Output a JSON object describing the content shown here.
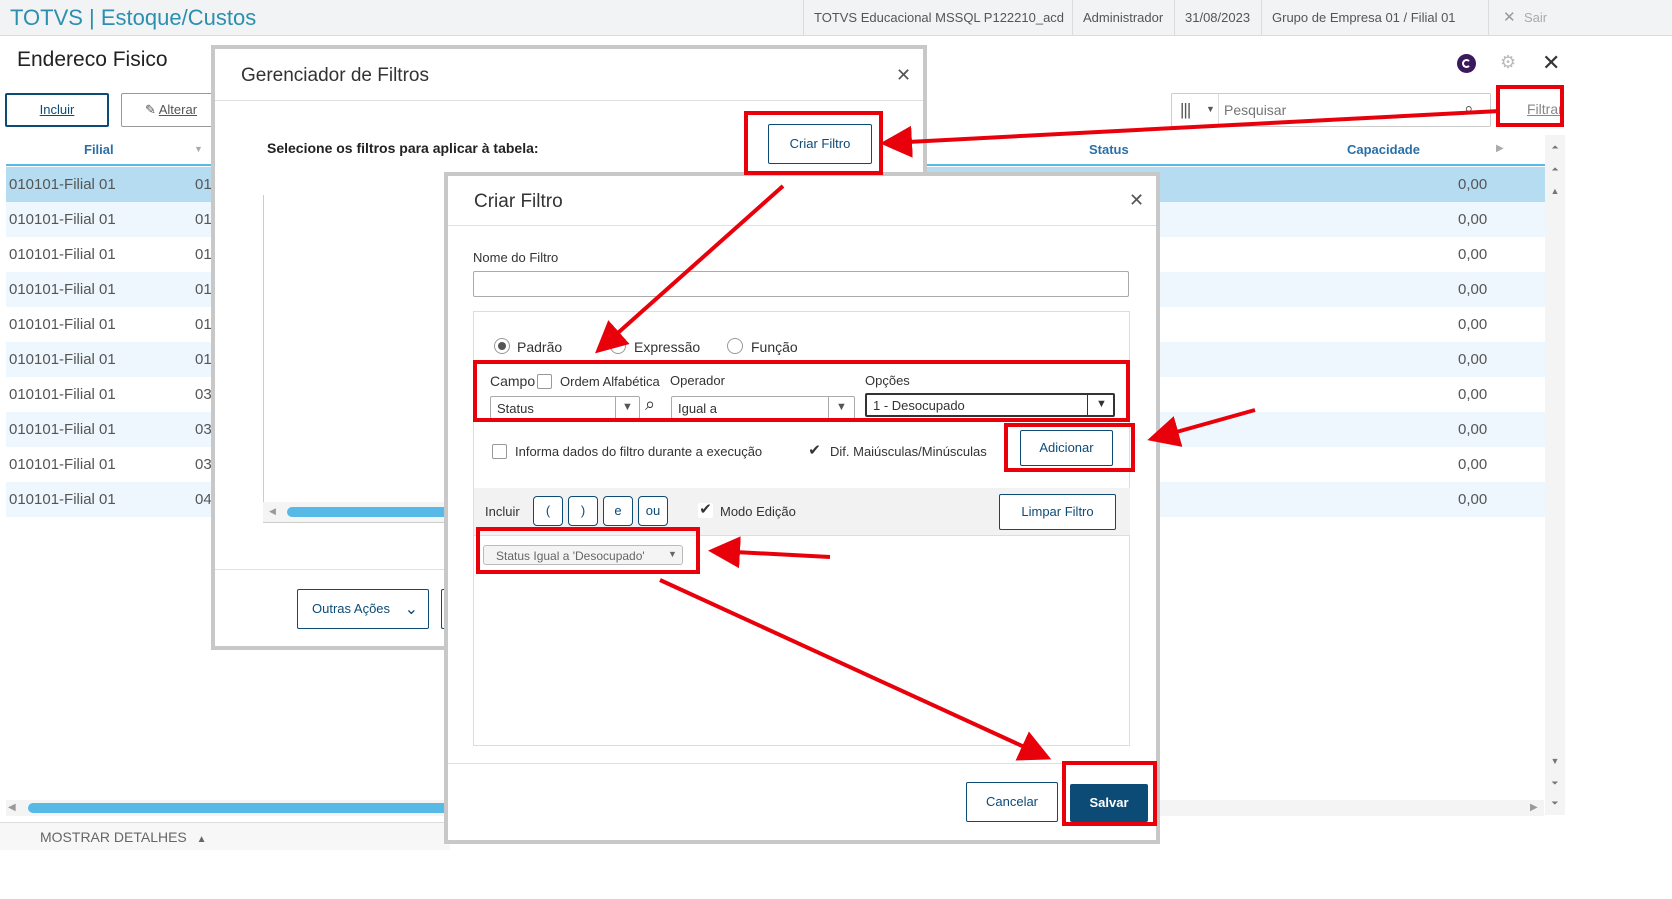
{
  "app": {
    "title": "TOTVS | Estoque/Custos",
    "environment": "TOTVS Educacional MSSQL P122210_acd",
    "user": "Administrador",
    "date": "31/08/2023",
    "company": "Grupo de Empresa 01 / Filial 01",
    "exit_label": "Sair"
  },
  "page": {
    "title": "Endereco Fisico",
    "include_label": "Incluir",
    "alter_label": "Alterar",
    "search_placeholder": "Pesquisar",
    "filter_label": "Filtrar",
    "show_details_label": "MOSTRAR DETALHES"
  },
  "grid": {
    "headers": {
      "filial": "Filial",
      "status": "Status",
      "capacidade": "Capacidade"
    },
    "rows": [
      {
        "filial": "010101-Filial 01",
        "code": "01",
        "capacidade": "0,00"
      },
      {
        "filial": "010101-Filial 01",
        "code": "01",
        "capacidade": "0,00"
      },
      {
        "filial": "010101-Filial 01",
        "code": "01",
        "capacidade": "0,00"
      },
      {
        "filial": "010101-Filial 01",
        "code": "01",
        "capacidade": "0,00"
      },
      {
        "filial": "010101-Filial 01",
        "code": "01",
        "capacidade": "0,00"
      },
      {
        "filial": "010101-Filial 01",
        "code": "01",
        "capacidade": "0,00"
      },
      {
        "filial": "010101-Filial 01",
        "code": "03",
        "capacidade": "0,00"
      },
      {
        "filial": "010101-Filial 01",
        "code": "03",
        "capacidade": "0,00"
      },
      {
        "filial": "010101-Filial 01",
        "code": "03",
        "capacidade": "0,00"
      },
      {
        "filial": "010101-Filial 01",
        "code": "04",
        "capacidade": "0,00"
      }
    ]
  },
  "filter_manager": {
    "title": "Gerenciador de Filtros",
    "instruction": "Selecione os filtros para aplicar à tabela:",
    "create_filter_label": "Criar Filtro",
    "other_actions_label": "Outras Ações"
  },
  "create_filter": {
    "title": "Criar Filtro",
    "name_label": "Nome do Filtro",
    "name_value": "",
    "radio_padrao": "Padrão",
    "radio_expressao": "Expressão",
    "radio_funcao": "Função",
    "field_label": "Campo",
    "alpha_order_label": "Ordem Alfabética",
    "operator_label": "Operador",
    "options_label": "Opções",
    "field_value": "Status",
    "operator_value": "Igual a",
    "option_value": "1 - Desocupado",
    "runtime_info_label": "Informa dados do filtro durante a execução",
    "case_sensitive_label": "Dif. Maiúsculas/Minúsculas",
    "add_label": "Adicionar",
    "include_label": "Incluir",
    "paren_open": "(",
    "paren_close": ")",
    "and_label": "e",
    "or_label": "ou",
    "edit_mode_label": "Modo Edição",
    "clear_filter_label": "Limpar Filtro",
    "expression_chip": "Status Igual a 'Desocupado'",
    "cancel_label": "Cancelar",
    "save_label": "Salvar"
  },
  "colors": {
    "accent": "#0c4b76",
    "highlight": "#e8000b",
    "row_selected": "#b6dcf2",
    "title_teal": "#2b8fb0"
  }
}
